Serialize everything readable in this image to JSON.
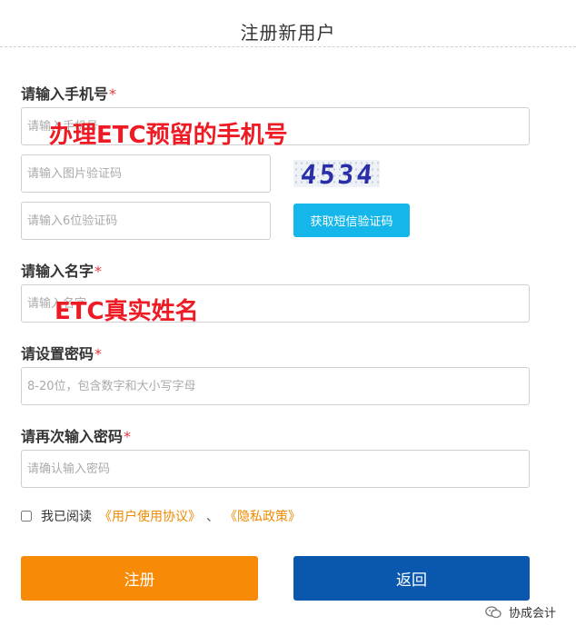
{
  "header": {
    "title": "注册新用户"
  },
  "phone": {
    "label": "请输入手机号",
    "required_mark": "*",
    "placeholder": "请输入手机号",
    "annotation": "办理ETC预留的手机号"
  },
  "image_code": {
    "placeholder": "请输入图片验证码",
    "captcha_text": "4534"
  },
  "sms_code": {
    "placeholder": "请输入6位验证码",
    "button_label": "获取短信验证码"
  },
  "name": {
    "label": "请输入名字",
    "required_mark": "*",
    "placeholder": "请输入名字",
    "annotation": "ETC真实姓名"
  },
  "password": {
    "label": "请设置密码",
    "required_mark": "*",
    "placeholder": "8-20位，包含数字和大小写字母"
  },
  "confirm_password": {
    "label": "请再次输入密码",
    "required_mark": "*",
    "placeholder": "请确认输入密码"
  },
  "agreement": {
    "prefix": "我已阅读",
    "user_agreement": "《用户使用协议》",
    "separator": "、",
    "privacy_policy": "《隐私政策》",
    "checked": false
  },
  "buttons": {
    "register": "注册",
    "back": "返回"
  },
  "watermark": {
    "text": "协成会计"
  },
  "colors": {
    "required": "#e4393c",
    "annotation": "#ee1b24",
    "sms_button": "#15b7ea",
    "register_button": "#f78a06",
    "back_button": "#0a58ae",
    "link": "#f08a00"
  }
}
